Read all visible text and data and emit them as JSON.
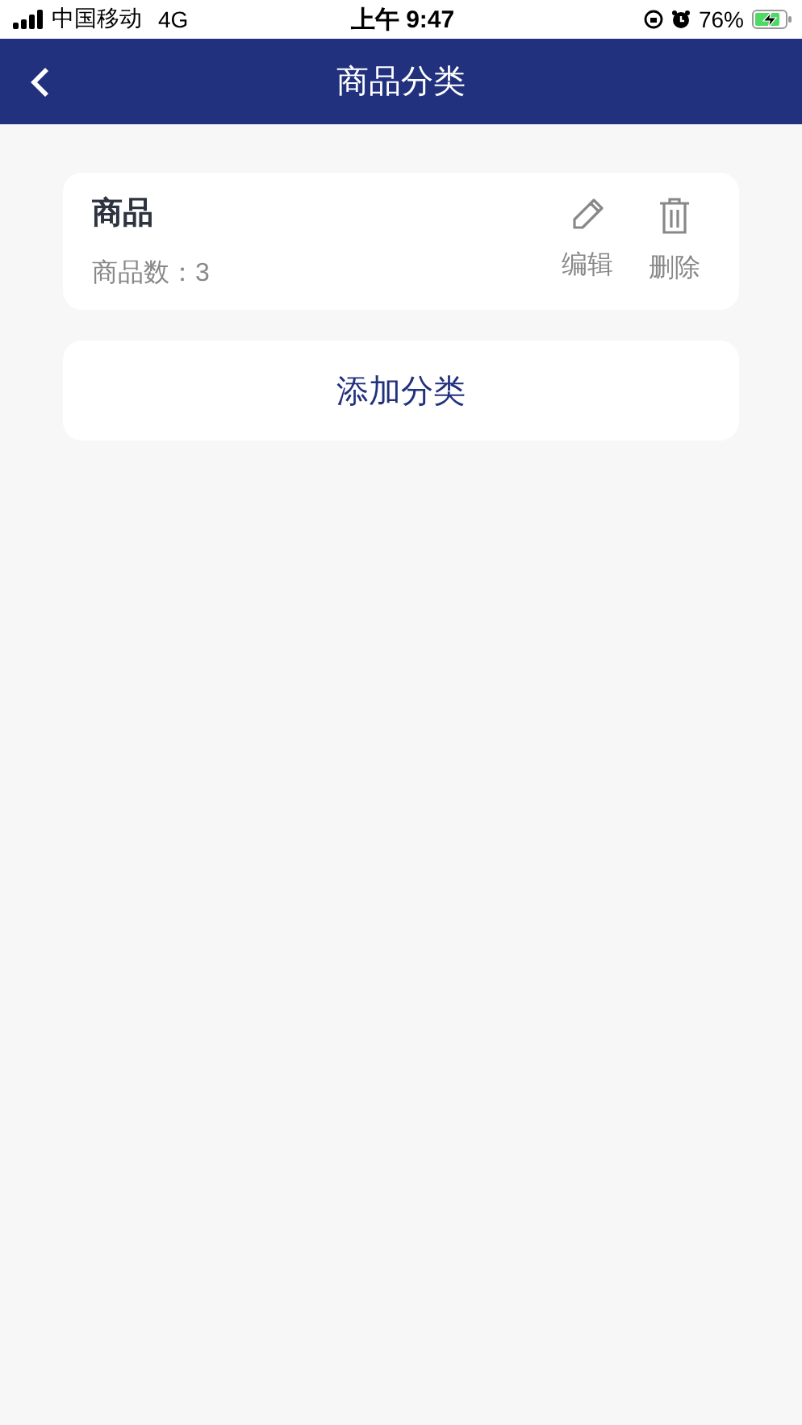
{
  "status_bar": {
    "carrier": "中国移动",
    "network": "4G",
    "time": "上午 9:47",
    "battery": "76%"
  },
  "nav": {
    "title": "商品分类"
  },
  "categories": [
    {
      "name": "商品",
      "count": "商品数：3",
      "actions": [
        {
          "kind": "edit",
          "label": "编辑"
        },
        {
          "kind": "delete",
          "label": "删除"
        }
      ]
    }
  ],
  "add_button": "添加分类"
}
